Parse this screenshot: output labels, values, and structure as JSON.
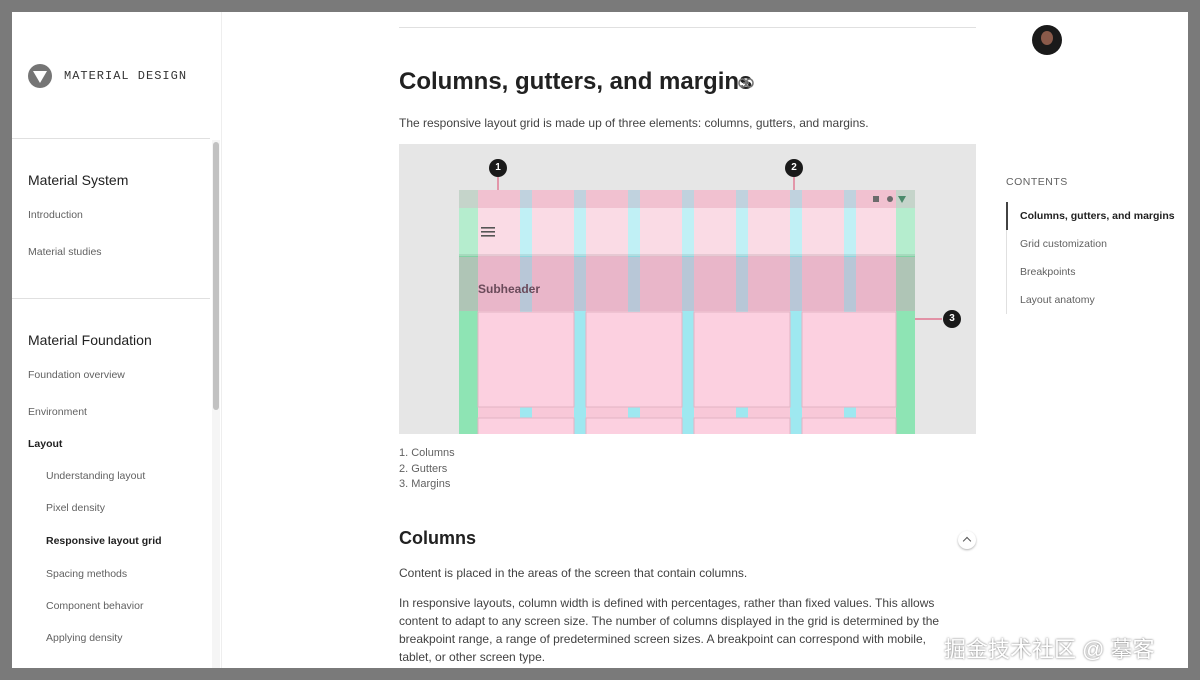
{
  "brand": {
    "name": "MATERIAL DESIGN"
  },
  "sidebar": {
    "section1": {
      "title": "Material System",
      "items": [
        "Introduction",
        "Material studies"
      ]
    },
    "section2": {
      "title": "Material Foundation",
      "items": [
        "Foundation overview",
        "Environment",
        "Layout"
      ],
      "sub_items": [
        "Understanding layout",
        "Pixel density",
        "Responsive layout grid",
        "Spacing methods",
        "Component behavior",
        "Applying density"
      ],
      "active_sub_item": "Responsive layout grid"
    }
  },
  "main": {
    "title": "Columns, gutters, and margins",
    "intro": "The responsive layout grid is made up of three elements: columns, gutters, and margins.",
    "figure": {
      "markers": [
        "1",
        "2",
        "3"
      ],
      "subheader": "Subheader",
      "colors": {
        "column": "#f8c8d8",
        "gutter": "#9ee8f0",
        "margin": "#8ee4b4",
        "background": "#e8e8e8",
        "marker": "#1a1a1a"
      }
    },
    "captions": [
      "1. Columns",
      "2. Gutters",
      "3. Margins"
    ],
    "section": {
      "title": "Columns",
      "para1": "Content is placed in the areas of the screen that contain columns.",
      "para2": "In responsive layouts, column width is defined with percentages, rather than fixed values. This allows content to adapt to any screen size. The number of columns displayed in the grid is determined by the breakpoint range, a range of predetermined screen sizes. A breakpoint can correspond with mobile, tablet, or other screen type."
    }
  },
  "contents": {
    "title": "CONTENTS",
    "items": [
      "Columns, gutters, and margins",
      "Grid customization",
      "Breakpoints",
      "Layout anatomy"
    ],
    "active": "Columns, gutters, and margins"
  },
  "watermark": "掘金技术社区 @ 摹客"
}
